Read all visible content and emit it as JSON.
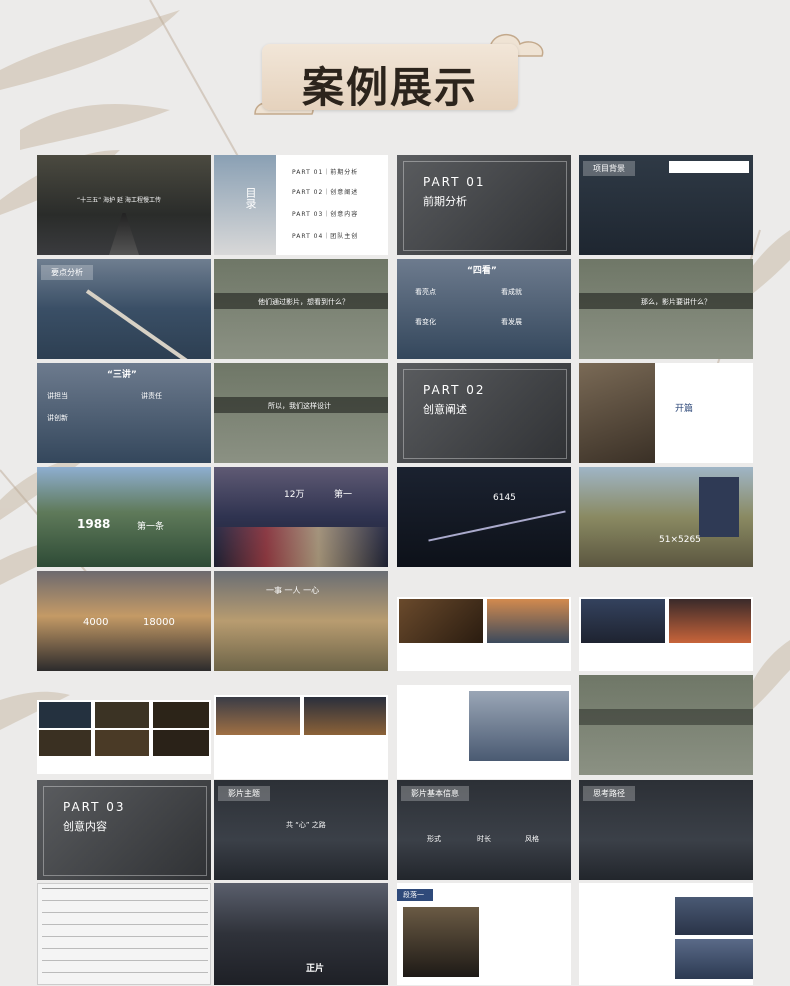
{
  "header": {
    "title": "案例展示"
  },
  "slides": {
    "s1": {
      "text": "“十三五” 海护 延 海工程慢工传"
    },
    "s2": {
      "side": "目录",
      "items": [
        "PART 01｜前期分析",
        "PART 02｜创意阐述",
        "PART 03｜创意内容",
        "PART 04｜团队主创"
      ]
    },
    "s3": {
      "part": "PART 01",
      "sub": "前期分析"
    },
    "s4": {
      "tag": "项目背景"
    },
    "s5": {
      "tag": "要点分析"
    },
    "s6": {
      "text": "他们通过影片，想看到什么？"
    },
    "s7": {
      "head": "“四看”",
      "items": [
        "看亮点",
        "看成就",
        "看变化",
        "看发展"
      ]
    },
    "s8": {
      "text": "那么，影片要讲什么？"
    },
    "s9": {
      "head": "“三讲”",
      "items": [
        "讲担当",
        "讲责任",
        "讲创新"
      ]
    },
    "s10": {
      "text": "所以，我们这样设计"
    },
    "s11": {
      "part": "PART 02",
      "sub": "创意阐述"
    },
    "s12": {
      "title": "开篇"
    },
    "s13": {
      "num": "1988",
      "unit": "第一条"
    },
    "s14": {
      "num": "12万",
      "unit": "第一"
    },
    "s15": {
      "num": "6145"
    },
    "s16": {
      "num": "51×5265"
    },
    "s17": {
      "n1": "4000",
      "n2": "18000"
    },
    "s18": {
      "text": "一事 一人 一心"
    },
    "s27": {
      "part": "PART 03",
      "sub": "创意内容"
    },
    "s28": {
      "tag": "影片主题",
      "quote": "共 “心” 之路"
    },
    "s29": {
      "tag": "影片基本信息",
      "cols": [
        "形式",
        "时长",
        "风格"
      ]
    },
    "s30": {
      "tag": "思考路径"
    },
    "s32": {
      "text": "正片"
    },
    "s33": {
      "tag": "段落一"
    }
  },
  "colors": {
    "accent": "#2f4a7a",
    "plate": "#e8d6c2",
    "text": "#2c241c"
  }
}
